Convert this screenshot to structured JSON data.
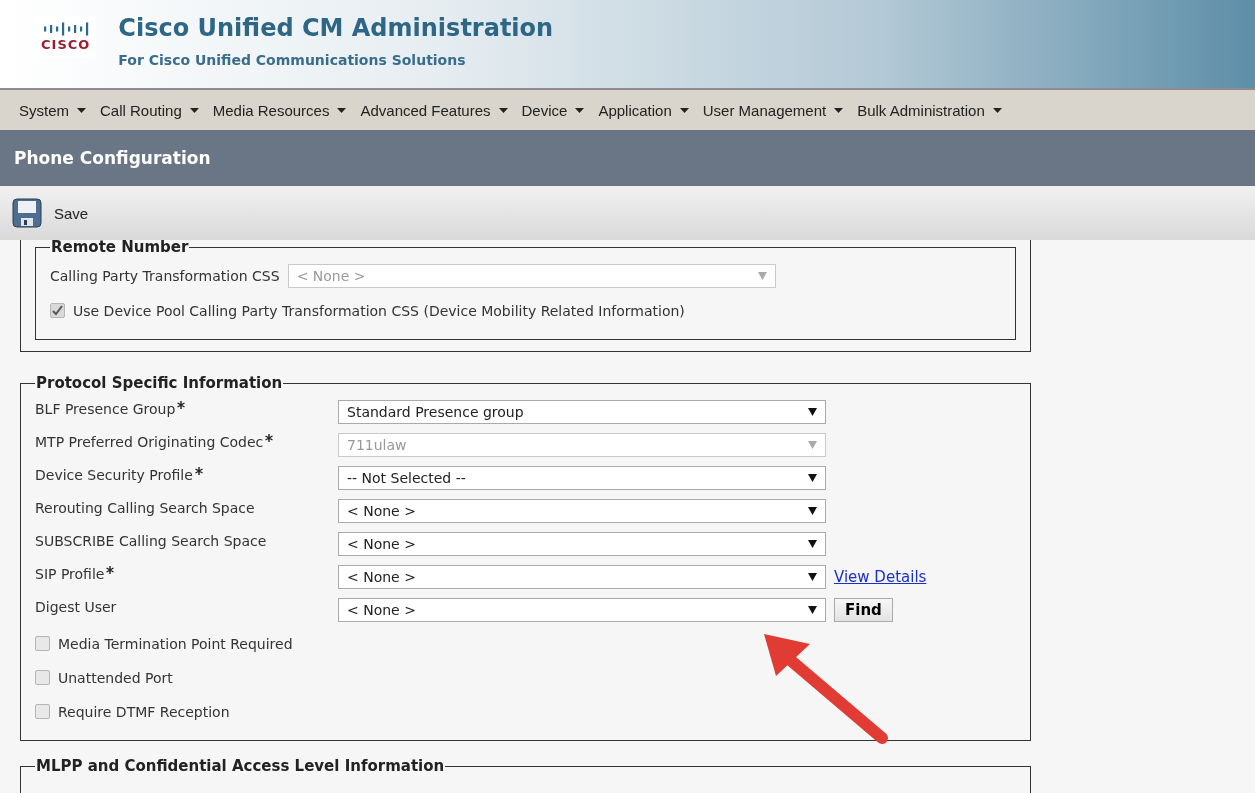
{
  "header": {
    "logo_text": "CISCO",
    "title": "Cisco Unified CM Administration",
    "subtitle": "For Cisco Unified Communications Solutions"
  },
  "menu": [
    "System",
    "Call Routing",
    "Media Resources",
    "Advanced Features",
    "Device",
    "Application",
    "User Management",
    "Bulk Administration"
  ],
  "page_title": "Phone Configuration",
  "toolbar": {
    "save": "Save"
  },
  "remote_number": {
    "legend": "Remote Number",
    "fields": [
      {
        "label": "Calling Party Transformation CSS",
        "value": "< None >",
        "disabled": true
      }
    ],
    "checkboxes": [
      {
        "label": "Use Device Pool Calling Party Transformation CSS (Device Mobility Related Information)",
        "checked": true
      }
    ]
  },
  "protocol": {
    "legend": "Protocol Specific Information",
    "fields": [
      {
        "label": "BLF Presence Group",
        "required": true,
        "value": "Standard Presence group",
        "disabled": false
      },
      {
        "label": "MTP Preferred Originating Codec",
        "required": true,
        "value": "711ulaw",
        "disabled": true
      },
      {
        "label": "Device Security Profile",
        "required": true,
        "value": "-- Not Selected --",
        "disabled": false
      },
      {
        "label": "Rerouting Calling Search Space",
        "required": false,
        "value": "< None >",
        "disabled": false
      },
      {
        "label": "SUBSCRIBE Calling Search Space",
        "required": false,
        "value": "< None >",
        "disabled": false
      },
      {
        "label": "SIP Profile",
        "required": true,
        "value": "< None >",
        "disabled": false,
        "side": {
          "kind": "link",
          "text": "View Details"
        }
      },
      {
        "label": "Digest User",
        "required": false,
        "value": "< None >",
        "disabled": false,
        "side": {
          "kind": "button",
          "text": "Find"
        }
      }
    ],
    "checkboxes": [
      {
        "label": "Media Termination Point Required",
        "checked": false
      },
      {
        "label": "Unattended Port",
        "checked": false
      },
      {
        "label": "Require DTMF Reception",
        "checked": false
      }
    ]
  },
  "next_section": {
    "legend": "MLPP and Confidential Access Level Information"
  }
}
